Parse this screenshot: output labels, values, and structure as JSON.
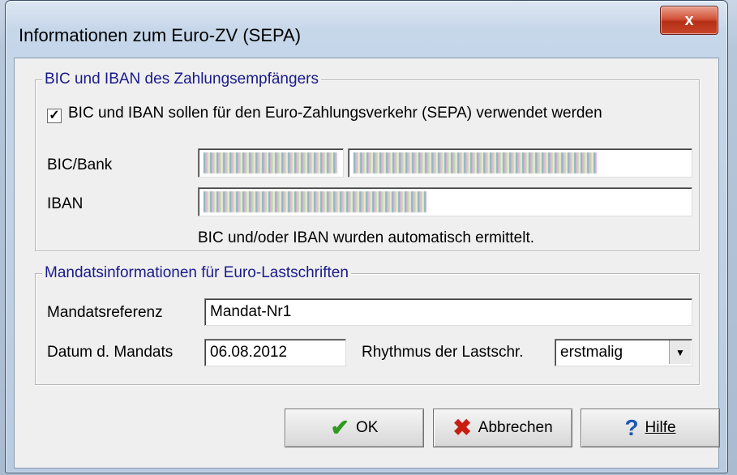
{
  "window": {
    "title": "Informationen zum Euro-ZV (SEPA)",
    "close_glyph": "x"
  },
  "group_bic": {
    "title": "BIC und IBAN des Zahlungsempfängers",
    "checkbox_checked": true,
    "checkbox_label": "BIC und IBAN sollen für den Euro-Zahlungsverkehr (SEPA) verwendet werden",
    "bic_label": "BIC/Bank",
    "iban_label": "IBAN",
    "info_text": "BIC und/oder IBAN wurden automatisch ermittelt."
  },
  "group_mandat": {
    "title": "Mandatsinformationen für Euro-Lastschriften",
    "ref_label": "Mandatsreferenz",
    "ref_value": "Mandat-Nr1",
    "date_label": "Datum d. Mandats",
    "date_value": "06.08.2012",
    "rhythm_label": "Rhythmus der Lastschr.",
    "rhythm_value": "erstmalig"
  },
  "buttons": {
    "ok": "OK",
    "cancel": "Abbrechen",
    "help": "Hilfe"
  },
  "icons": {
    "ok": "check-icon",
    "cancel": "x-icon",
    "help": "question-icon"
  }
}
